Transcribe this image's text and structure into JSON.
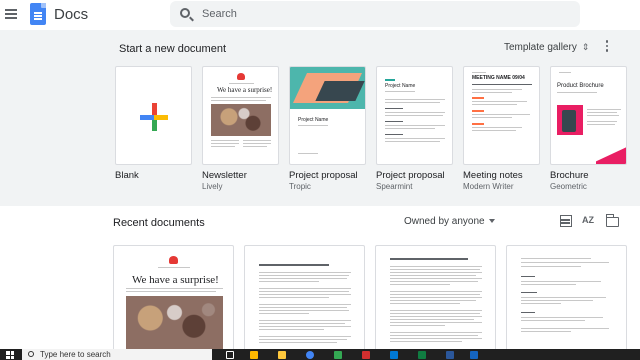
{
  "header": {
    "app_title": "Docs",
    "search_placeholder": "Search",
    "menu_icon": "hamburger-menu-icon",
    "logo_icon": "docs-logo-icon"
  },
  "templates_section": {
    "title": "Start a new document",
    "gallery_label": "Template gallery",
    "gallery_icon": "unfold-more-icon",
    "more_icon": "more-vert-icon",
    "templates": [
      {
        "name": "Blank",
        "sub": ""
      },
      {
        "name": "Newsletter",
        "sub": "Lively",
        "thumb_heading": "We have a surprise!"
      },
      {
        "name": "Project proposal",
        "sub": "Tropic",
        "thumb_heading": "Project Name"
      },
      {
        "name": "Project proposal",
        "sub": "Spearmint",
        "thumb_heading": "Project Name"
      },
      {
        "name": "Meeting notes",
        "sub": "Modern Writer",
        "thumb_heading": "MEETING NAME 09/04"
      },
      {
        "name": "Brochure",
        "sub": "Geometric",
        "thumb_heading": "Product Brochure"
      }
    ]
  },
  "recent_section": {
    "title": "Recent documents",
    "owner_filter": "Owned by anyone",
    "sort_label": "AZ",
    "doc1_heading": "We have a surprise!"
  },
  "taskbar": {
    "search_placeholder": "Type here to search"
  },
  "colors": {
    "accent_blue": "#4285f4",
    "template_bg": "#f1f3f4",
    "newsletter_red": "#e53935",
    "tropic_teal": "#4db6ac",
    "tropic_orange": "#f4a37c",
    "brochure_pink": "#e91e63"
  }
}
